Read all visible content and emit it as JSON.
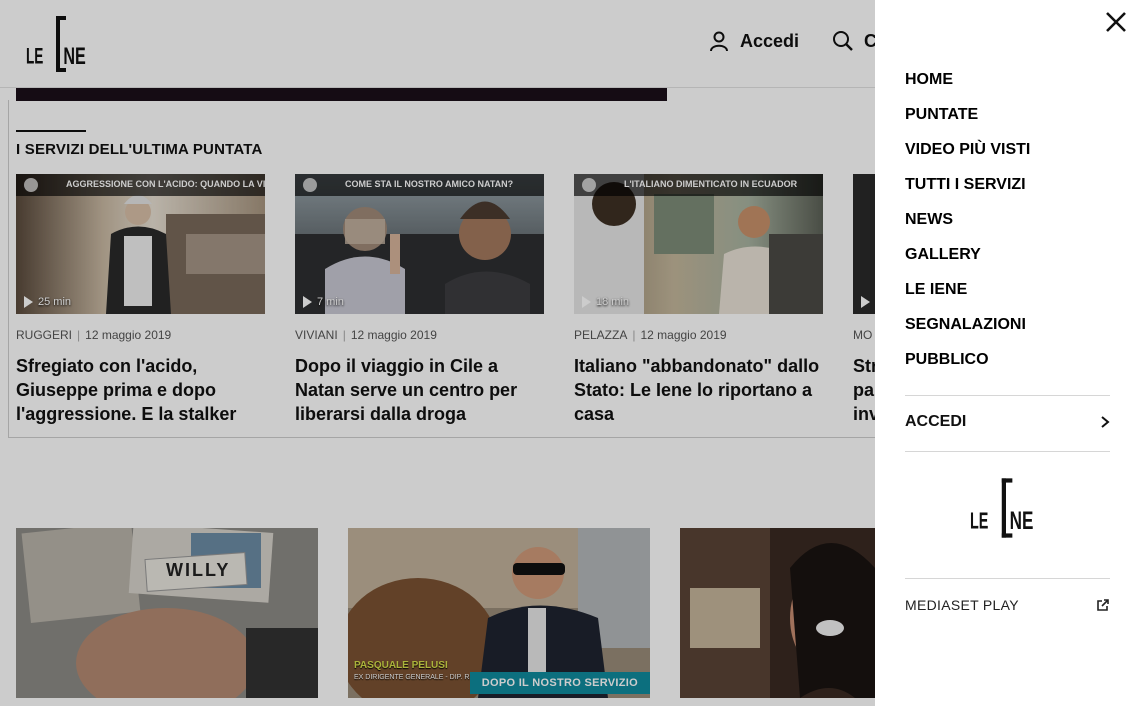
{
  "header": {
    "logo_text": "LE IENE",
    "login_label": "Accedi",
    "search_label": "C"
  },
  "section": {
    "title": "I SERVIZI DELL'ULTIMA PUNTATA"
  },
  "cards": [
    {
      "caption": "AGGRESSIONE CON L'ACIDO: QUANDO LA VITTIMA È UN UOMO",
      "duration": "25 min",
      "author": "RUGGERI",
      "date": "12 maggio 2019",
      "headline": "Sfregiato con l'acido, Giuseppe prima e dopo l'aggressione. E la stalker"
    },
    {
      "caption": "COME STA IL NOSTRO AMICO NATAN?",
      "duration": "7 min",
      "author": "VIVIANI",
      "date": "12 maggio 2019",
      "headline": "Dopo il viaggio in Cile a Natan serve un centro per liberarsi dalla droga"
    },
    {
      "caption": "L'ITALIANO DIMENTICATO IN ECUADOR",
      "duration": "18 min",
      "author": "PELAZZA",
      "date": "12 maggio 2019",
      "headline": "Italiano \"abbandonato\" dallo Stato: Le Iene lo riportano a casa"
    },
    {
      "caption": "",
      "duration": "",
      "author": "MO",
      "date": "",
      "headline": "Str pa inv"
    }
  ],
  "tiles": [
    {
      "label": "WILLY",
      "tag": ""
    },
    {
      "label": "PASQUALE PELUSI",
      "sublabel": "EX DIRIGENTE GENERALE - DIP. RISORSE EC",
      "tag": "DOPO IL NOSTRO SERVIZIO"
    },
    {
      "label": "",
      "tag": ""
    }
  ],
  "menu": {
    "items": [
      "HOME",
      "PUNTATE",
      "VIDEO PIÙ VISTI",
      "TUTTI I SERVIZI",
      "NEWS",
      "GALLERY",
      "LE IENE",
      "SEGNALAZIONI",
      "PUBBLICO"
    ],
    "login_label": "ACCEDI",
    "logo_text": "LE IENE",
    "mediaset_label": "MEDIASET PLAY"
  },
  "colors": {
    "accent_tag": "#0f8b9e",
    "overlay": "rgba(0,0,0,0.2)"
  }
}
